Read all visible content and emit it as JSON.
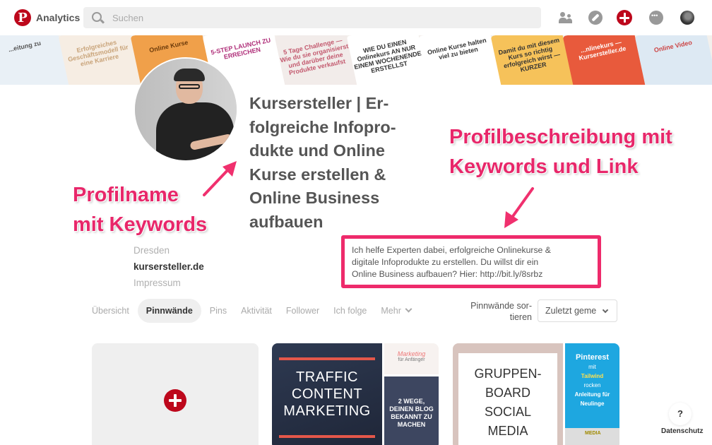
{
  "topbar": {
    "brand": "Analytics",
    "search_placeholder": "Suchen",
    "icons": [
      "pinterest-logo",
      "search-icon",
      "people-icon",
      "compass-icon",
      "add-icon",
      "chat-icon",
      "user-avatar"
    ]
  },
  "banner": {
    "tiles": [
      {
        "text": "...eitung zu",
        "bg": "#e9f0f6",
        "color": "#555"
      },
      {
        "text": "Erfolgreiches Geschäftsmodell für eine Karriere",
        "bg": "#f6ede3",
        "color": "#c9a47a"
      },
      {
        "text": "Online Kurse",
        "bg": "#f0a04a",
        "color": "#6b3a0a"
      },
      {
        "text": "5-STEP LAUNCH ZU ERREICHEN",
        "bg": "#ffffff",
        "color": "#b0307a"
      },
      {
        "text": "5 Tage Challenge — Wie du sie organisierst und darüber deine Produkte verkaufst",
        "bg": "#f2ecea",
        "color": "#c35a6f"
      },
      {
        "text": "WIE DU EINEN Onlinekurs AN NUR EINEM WOCHENENDE ERSTELLST",
        "bg": "#ffffff",
        "color": "#333"
      },
      {
        "text": "Online Kurse halten viel zu bieten",
        "bg": "#ffffff",
        "color": "#333"
      },
      {
        "text": "Damit du mit diesem Kurs so richtig erfolgreich wirst — KURZER",
        "bg": "#f6c25a",
        "color": "#333"
      },
      {
        "text": "...nlinekurs — Kursersteller.de",
        "bg": "#e85a3c",
        "color": "#fff"
      },
      {
        "text": "Online Video",
        "bg": "#dde9f3",
        "color": "#c44"
      }
    ]
  },
  "profile": {
    "name": "Kursersteller | Er-folgreiche Infopro-dukte und Online Kurse erstellen & Online Business aufbauen",
    "name_lines": [
      "Kursersteller | Er-",
      "folgreiche Infopro-",
      "dukte und Online",
      "Kurse erstellen &",
      "Online Business",
      "aufbauen"
    ],
    "location": "Dresden",
    "website": "kursersteller.de",
    "imprint": "Impressum",
    "description_lines": [
      "Ich helfe Experten dabei, erfolgreiche Onlinekurse &",
      "digitale Infoprodukte zu erstellen. Du willst dir ein",
      "Online Business aufbauen? Hier: http://bit.ly/8srbz"
    ]
  },
  "annotations": {
    "name_label_lines": [
      "Profilname",
      "mit Keywords"
    ],
    "desc_label_lines": [
      "Profilbeschreibung mit",
      "Keywords und Link"
    ],
    "accent_color": "#e8276a"
  },
  "tabs": [
    {
      "label": "Übersicht",
      "active": false
    },
    {
      "label": "Pinnwände",
      "active": true
    },
    {
      "label": "Pins",
      "active": false
    },
    {
      "label": "Aktivität",
      "active": false
    },
    {
      "label": "Follower",
      "active": false
    },
    {
      "label": "Ich folge",
      "active": false
    },
    {
      "label": "Mehr",
      "active": false
    }
  ],
  "sort": {
    "label": "Pinnwände sor-tieren",
    "label_lines": [
      "Pinnwände sor-",
      "tieren"
    ],
    "selected": "Zuletzt geme"
  },
  "boards": [
    {
      "type": "create"
    },
    {
      "main_lines": [
        "TRAFFIC",
        "CONTENT",
        "MARKETING"
      ],
      "top_right_script": "Marketing",
      "top_right_sub": "für Anfänger",
      "bottom_right_lines": [
        "2 WEGE,",
        "DEINEN BLOG",
        "BEKANNT ZU",
        "MACHEN"
      ]
    },
    {
      "main_lines": [
        "GRUPPEN-",
        "BOARD",
        "SOCIAL",
        "MEDIA"
      ],
      "right_brand": "Pinterest",
      "right_lines": [
        "mit",
        "Tailwind",
        "rocken",
        "Anleitung für Neulinge"
      ],
      "right_bottom": "MEDIA"
    }
  ],
  "help": {
    "button": "?",
    "privacy": "Datenschutz"
  },
  "colors": {
    "pinterest_red": "#bd081c",
    "highlight_pink": "#ee2a6b"
  }
}
